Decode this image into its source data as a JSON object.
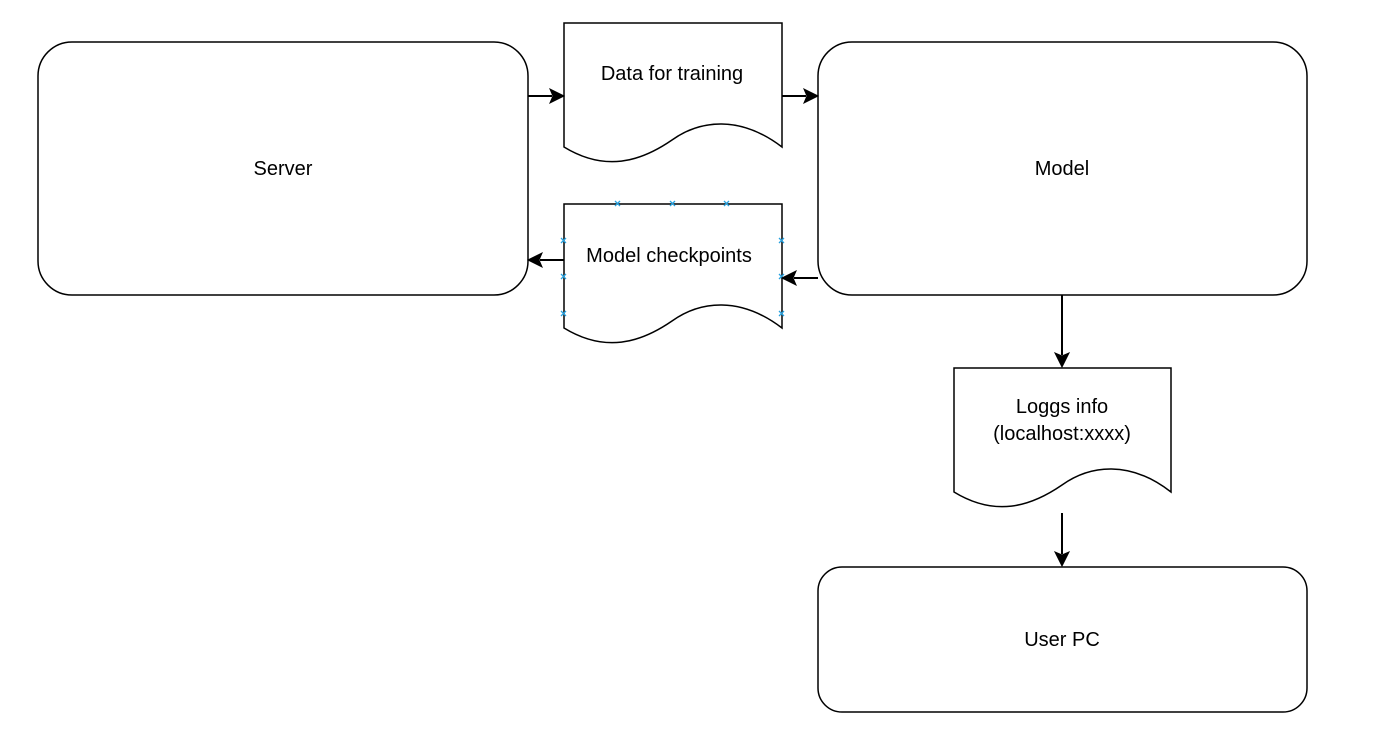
{
  "nodes": {
    "server": {
      "label": "Server"
    },
    "data_training": {
      "label": "Data for training"
    },
    "model": {
      "label": "Model"
    },
    "model_checkpoints": {
      "label": "Model checkpoints"
    },
    "logs_info": {
      "line1": "Loggs info",
      "line2": "(localhost:xxxx)"
    },
    "user_pc": {
      "label": "User PC"
    }
  },
  "edges": [
    {
      "from": "server",
      "to": "data_training"
    },
    {
      "from": "data_training",
      "to": "model"
    },
    {
      "from": "model",
      "to": "model_checkpoints"
    },
    {
      "from": "model_checkpoints",
      "to": "server"
    },
    {
      "from": "model",
      "to": "logs_info"
    },
    {
      "from": "logs_info",
      "to": "user_pc"
    }
  ],
  "colors": {
    "stroke": "#000000",
    "fill": "#ffffff",
    "selection_handle": "#29a3e0"
  }
}
